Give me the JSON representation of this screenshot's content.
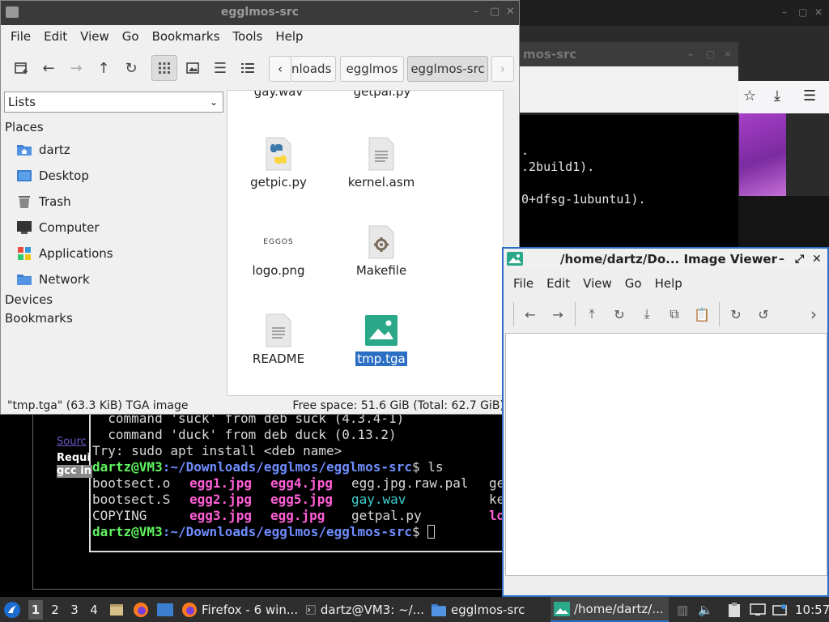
{
  "browser_bg": {
    "lines": [
      ".",
      ".2build1).",
      "",
      "0+dfsg-1ubuntu1)."
    ]
  },
  "term2": {
    "title": "mos-src"
  },
  "terminal": {
    "side_links": [
      "Sourc",
      "Requi",
      "gcc in"
    ],
    "lines": [
      {
        "plain": "  command 'suck' from deb suck (4.3.4-1)"
      },
      {
        "plain": "  command 'duck' from deb duck (0.13.2)"
      },
      {
        "plain": "Try: sudo apt install <deb name>"
      },
      {
        "prompt_user": "dartz@VM3",
        "prompt_path": ":~/Downloads/egglmos/egglmos-src",
        "cmd": "$ ls"
      },
      {
        "cols": [
          "bootsect.o",
          "egg1.jpg",
          "egg4.jpg",
          "egg.jpg.raw.pal",
          "ge"
        ]
      },
      {
        "cols": [
          "bootsect.S",
          "egg2.jpg",
          "egg5.jpg",
          "gay.wav",
          "ke"
        ]
      },
      {
        "cols": [
          "COPYING",
          "egg3.jpg",
          "egg.jpg",
          "getpal.py",
          "lo"
        ]
      },
      {
        "prompt_user": "dartz@VM3",
        "prompt_path": ":~/Downloads/egglmos/egglmos-src",
        "cmd": "$ "
      }
    ]
  },
  "file_manager": {
    "title": "egglmos-src",
    "menu": [
      "File",
      "Edit",
      "View",
      "Go",
      "Bookmarks",
      "Tools",
      "Help"
    ],
    "breadcrumbs": [
      "nloads",
      "egglmos",
      "egglmos-src"
    ],
    "lists_label": "Lists",
    "sections": {
      "places": "Places",
      "devices": "Devices",
      "bookmarks": "Bookmarks"
    },
    "places": [
      {
        "label": "dartz",
        "icon": "home-folder-icon"
      },
      {
        "label": "Desktop",
        "icon": "desktop-icon"
      },
      {
        "label": "Trash",
        "icon": "trash-icon"
      },
      {
        "label": "Computer",
        "icon": "computer-icon"
      },
      {
        "label": "Applications",
        "icon": "applications-icon"
      },
      {
        "label": "Network",
        "icon": "network-icon"
      }
    ],
    "files_partial": [
      "gay.wav",
      "getpal.py"
    ],
    "files": [
      {
        "name": "getpic.py",
        "icon": "python-file-icon"
      },
      {
        "name": "kernel.asm",
        "icon": "text-file-icon"
      },
      {
        "name": "logo.png",
        "icon": "image-thumbnail-icon",
        "thumb_text": "EGGOS"
      },
      {
        "name": "Makefile",
        "icon": "makefile-icon"
      },
      {
        "name": "README",
        "icon": "text-file-icon"
      },
      {
        "name": "tmp.tga",
        "icon": "image-file-icon",
        "selected": true
      }
    ],
    "status_left": "\"tmp.tga\" (63.3 KiB) TGA image",
    "status_right": "Free space: 51.6 GiB (Total: 62.7 GiB)"
  },
  "image_viewer": {
    "title": "/home/dartz/Do... Image Viewer",
    "menu": [
      "File",
      "Edit",
      "View",
      "Go",
      "Help"
    ]
  },
  "taskbar": {
    "workspaces": [
      "1",
      "2",
      "3",
      "4"
    ],
    "tasks": [
      {
        "label": "Firefox - 6 win...",
        "icon": "firefox-icon"
      },
      {
        "label": "dartz@VM3: ~/...",
        "icon": "terminal-icon"
      },
      {
        "label": "egglmos-src",
        "icon": "folder-icon"
      },
      {
        "label": "/home/dartz/...",
        "icon": "image-viewer-icon",
        "active": true
      }
    ],
    "clock": "10:57"
  }
}
